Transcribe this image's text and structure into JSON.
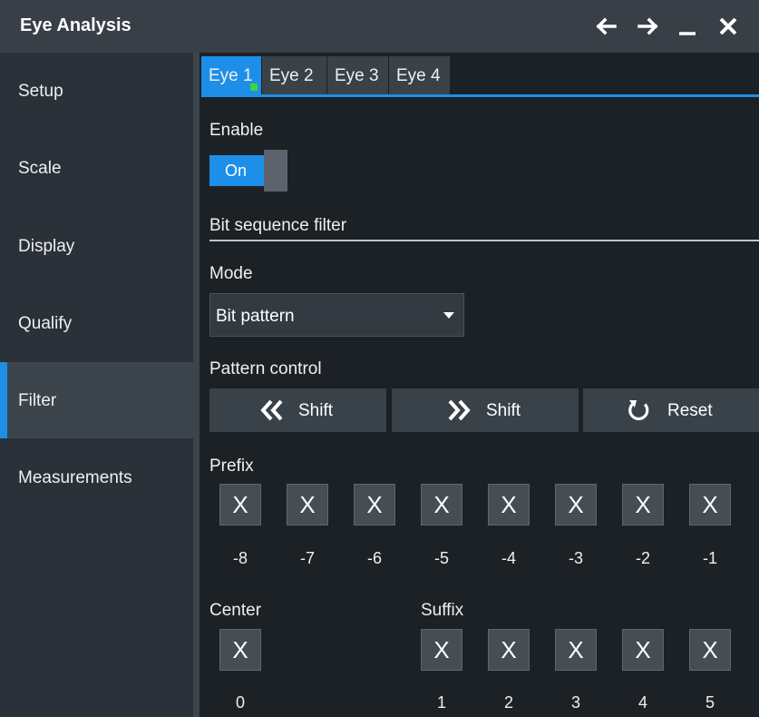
{
  "window": {
    "title": "Eye Analysis"
  },
  "sidebar": {
    "items": [
      {
        "label": "Setup",
        "active": false
      },
      {
        "label": "Scale",
        "active": false
      },
      {
        "label": "Display",
        "active": false
      },
      {
        "label": "Qualify",
        "active": false
      },
      {
        "label": "Filter",
        "active": true
      },
      {
        "label": "Measurements",
        "active": false
      }
    ]
  },
  "tabs": [
    {
      "label": "Eye 1",
      "active": true
    },
    {
      "label": "Eye 2",
      "active": false
    },
    {
      "label": "Eye 3",
      "active": false
    },
    {
      "label": "Eye 4",
      "active": false
    }
  ],
  "enable": {
    "label": "Enable",
    "value": "On"
  },
  "section": {
    "title": "Bit sequence filter"
  },
  "mode": {
    "label": "Mode",
    "value": "Bit pattern"
  },
  "pattern_control": {
    "label": "Pattern control",
    "shift_left_label": "Shift",
    "shift_right_label": "Shift",
    "reset_label": "Reset"
  },
  "prefix": {
    "label": "Prefix",
    "bits": [
      {
        "value": "X",
        "index": "-8"
      },
      {
        "value": "X",
        "index": "-7"
      },
      {
        "value": "X",
        "index": "-6"
      },
      {
        "value": "X",
        "index": "-5"
      },
      {
        "value": "X",
        "index": "-4"
      },
      {
        "value": "X",
        "index": "-3"
      },
      {
        "value": "X",
        "index": "-2"
      },
      {
        "value": "X",
        "index": "-1"
      }
    ]
  },
  "center": {
    "label": "Center",
    "bit": {
      "value": "X",
      "index": "0"
    }
  },
  "suffix": {
    "label": "Suffix",
    "bits": [
      {
        "value": "X",
        "index": "1"
      },
      {
        "value": "X",
        "index": "2"
      },
      {
        "value": "X",
        "index": "3"
      },
      {
        "value": "X",
        "index": "4"
      },
      {
        "value": "X",
        "index": "5"
      }
    ]
  },
  "colors": {
    "accent": "#1d8fe8",
    "indicator": "#3ad63a",
    "title_bar": "#383f46",
    "background": "#1c2126"
  },
  "icons": [
    "arrow-left-icon",
    "arrow-right-icon",
    "minimize-icon",
    "close-icon",
    "double-chevron-left-icon",
    "double-chevron-right-icon",
    "reset-icon",
    "dropdown-caret-icon"
  ]
}
